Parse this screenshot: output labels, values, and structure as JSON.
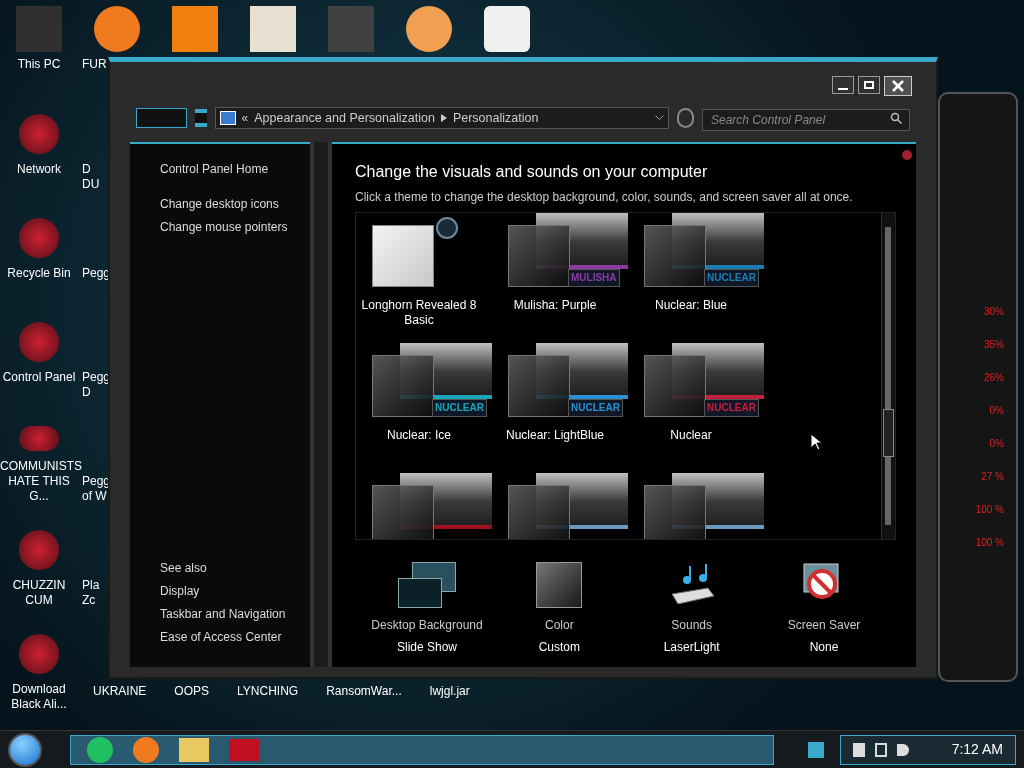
{
  "desktop": {
    "top_row_labels": [
      "This PC",
      "FUR"
    ],
    "left_column": [
      "Network",
      "Recycle Bin",
      "Control Panel",
      "COMMUNISTS HATE THIS G...",
      "CHUZZIN CUM",
      "Download Black Ali..."
    ],
    "partial_column": [
      "D\nDU",
      "Pegg",
      "Pegg\nD",
      "Pegg\nof W",
      "Pla\nZc"
    ],
    "bottom_row": [
      "UKRAINE",
      "OOPS",
      "LYNCHING",
      "RansomWar...",
      "lwjgl.jar"
    ]
  },
  "window": {
    "overflow_mark": "«",
    "breadcrumb": [
      "Appearance and Personalization",
      "Personalization"
    ],
    "search": {
      "placeholder": "Search Control Panel"
    },
    "sidebar": {
      "links": [
        "Control Panel Home",
        "Change desktop icons",
        "Change mouse pointers"
      ],
      "see_also_title": "See also",
      "see_also": [
        "Display",
        "Taskbar and Navigation",
        "Ease of Access Center"
      ]
    },
    "heading": "Change the visuals and sounds on your computer",
    "subtitle": "Click a theme to change the desktop background, color, sounds, and screen saver all at once.",
    "themes": [
      {
        "kind": "plain",
        "name": "Longhorn Revealed 8 Basic"
      },
      {
        "kind": "image",
        "name": "Mulisha: Purple",
        "banner": "MULISHA",
        "color": "#8a3aa0"
      },
      {
        "kind": "image",
        "name": "Nuclear: Blue",
        "banner": "NUCLEAR",
        "color": "#1a7fb0"
      },
      {
        "kind": "image",
        "name": "Nuclear: Ice",
        "banner": "NUCLEAR",
        "color": "#19a6b8"
      },
      {
        "kind": "image",
        "name": "Nuclear: LightBlue",
        "banner": "NUCLEAR",
        "color": "#2a90d0"
      },
      {
        "kind": "image",
        "name": "Nuclear",
        "banner": "NUCLEAR",
        "color": "#c0203a"
      },
      {
        "kind": "image",
        "color": "#a01020"
      },
      {
        "kind": "image",
        "color": "#6a9ac0"
      },
      {
        "kind": "image",
        "color": "#6a9ac0"
      }
    ],
    "settings": [
      {
        "kind": "background",
        "label": "Desktop Background",
        "value": "Slide Show"
      },
      {
        "kind": "color",
        "label": "Color",
        "value": "Custom"
      },
      {
        "kind": "sounds",
        "label": "Sounds",
        "value": "LaserLight"
      },
      {
        "kind": "screensaver",
        "label": "Screen Saver",
        "value": "None"
      }
    ]
  },
  "gadget": {
    "readings": [
      "30%",
      "35%",
      "26%",
      "0%",
      "0%",
      "27 %",
      "100 %",
      "100 %"
    ]
  },
  "taskbar": {
    "time": "7:12 AM"
  }
}
